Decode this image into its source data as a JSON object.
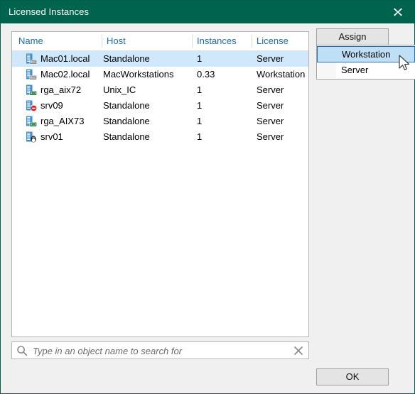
{
  "window": {
    "title": "Licensed Instances",
    "close_icon": "close-icon"
  },
  "table": {
    "columns": [
      {
        "key": "name",
        "label": "Name"
      },
      {
        "key": "host",
        "label": "Host"
      },
      {
        "key": "instances",
        "label": "Instances"
      },
      {
        "key": "license",
        "label": "License"
      }
    ],
    "rows": [
      {
        "icon": "mac-server-icon",
        "name": "Mac01.local",
        "host": "Standalone",
        "instances": "1",
        "license": "Server",
        "selected": true
      },
      {
        "icon": "mac-server-icon",
        "name": "Mac02.local",
        "host": "MacWorkstations",
        "instances": "0.33",
        "license": "Workstation",
        "selected": false
      },
      {
        "icon": "aix-server-icon",
        "name": "rga_aix72",
        "host": "Unix_IC",
        "instances": "1",
        "license": "Server",
        "selected": false
      },
      {
        "icon": "error-server-icon",
        "name": "srv09",
        "host": "Standalone",
        "instances": "1",
        "license": "Server",
        "selected": false
      },
      {
        "icon": "aix-server-icon",
        "name": "rga_AIX73",
        "host": "Standalone",
        "instances": "1",
        "license": "Server",
        "selected": false
      },
      {
        "icon": "linux-server-icon",
        "name": "srv01",
        "host": "Standalone",
        "instances": "1",
        "license": "Server",
        "selected": false
      }
    ]
  },
  "search": {
    "value": "",
    "placeholder": "Type in an object name to search for",
    "search_icon": "search-icon",
    "clear_icon": "clear-icon"
  },
  "buttons": {
    "assign": "Assign",
    "ok": "OK"
  },
  "dropdown": {
    "visible": true,
    "items": [
      {
        "label": "Workstation",
        "highlighted": true
      },
      {
        "label": "Server",
        "highlighted": false
      }
    ]
  },
  "colors": {
    "titlebar": "#00634e",
    "selection": "#cfe8fb",
    "header_text": "#1d6ca8",
    "dialog_bg": "#f0f0f0",
    "menu_highlight": "#bfdff7",
    "menu_highlight_border": "#2a6fb0"
  }
}
